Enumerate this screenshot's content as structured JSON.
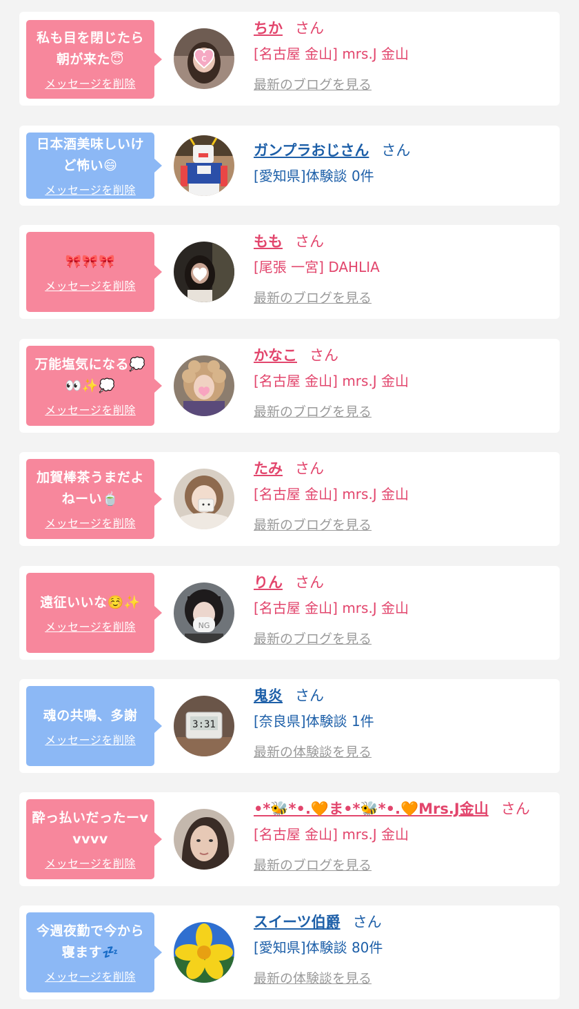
{
  "delete_label": "メッセージを削除",
  "honorific": "さん",
  "colors": {
    "pink": "#f7879c",
    "blue": "#8cb8f5",
    "pink_text": "#e2456c",
    "blue_text": "#1d5fa8"
  },
  "cards": [
    {
      "type": "pink",
      "message": "私も目を閉じたら朝が来た😇",
      "name": "ちか",
      "shop": "[名古屋 金山] mrs.J 金山",
      "latest": "最新のブログを見る",
      "avatar": "avatar-woman-blur"
    },
    {
      "type": "blue",
      "message": "日本酒美味しいけど怖い😄",
      "name": "ガンプラおじさん",
      "shop": "[愛知県]体験談 0件",
      "latest": "",
      "avatar": "avatar-robot"
    },
    {
      "type": "pink",
      "message": "🎀🎀🎀",
      "name": "もも",
      "shop": "[尾張 一宮] DAHLIA",
      "latest": "最新のブログを見る",
      "avatar": "avatar-woman-dark"
    },
    {
      "type": "pink",
      "message": "万能塩気になる💭👀✨💭",
      "name": "かなこ",
      "shop": "[名古屋 金山] mrs.J 金山",
      "latest": "最新のブログを見る",
      "avatar": "avatar-woman-curls"
    },
    {
      "type": "pink",
      "message": "加賀棒茶うまだよねーい🍵",
      "name": "たみ",
      "shop": "[名古屋 金山] mrs.J 金山",
      "latest": "最新のブログを見る",
      "avatar": "avatar-woman-light"
    },
    {
      "type": "pink",
      "message": "遠征いいな☺️✨",
      "name": "りん",
      "shop": "[名古屋 金山] mrs.J 金山",
      "latest": "最新のブログを見る",
      "avatar": "avatar-woman-mask"
    },
    {
      "type": "blue",
      "message": "魂の共鳴、多謝",
      "name": "鬼炎",
      "shop": "[奈良県]体験談 1件",
      "latest": "最新の体験談を見る",
      "avatar": "avatar-clock"
    },
    {
      "type": "pink",
      "message": "酔っ払いだったーvvvvv",
      "name": "•*🐝*•.🧡ま•*🐝*•.🧡Mrs.J金山",
      "shop": "[名古屋 金山] mrs.J 金山",
      "latest": "最新のブログを見る",
      "avatar": "avatar-woman-portrait"
    },
    {
      "type": "blue",
      "message": "今週夜勤で今から寝ます💤",
      "name": "スイーツ伯爵",
      "shop": "[愛知県]体験談 80件",
      "latest": "最新の体験談を見る",
      "avatar": "avatar-flower"
    }
  ]
}
